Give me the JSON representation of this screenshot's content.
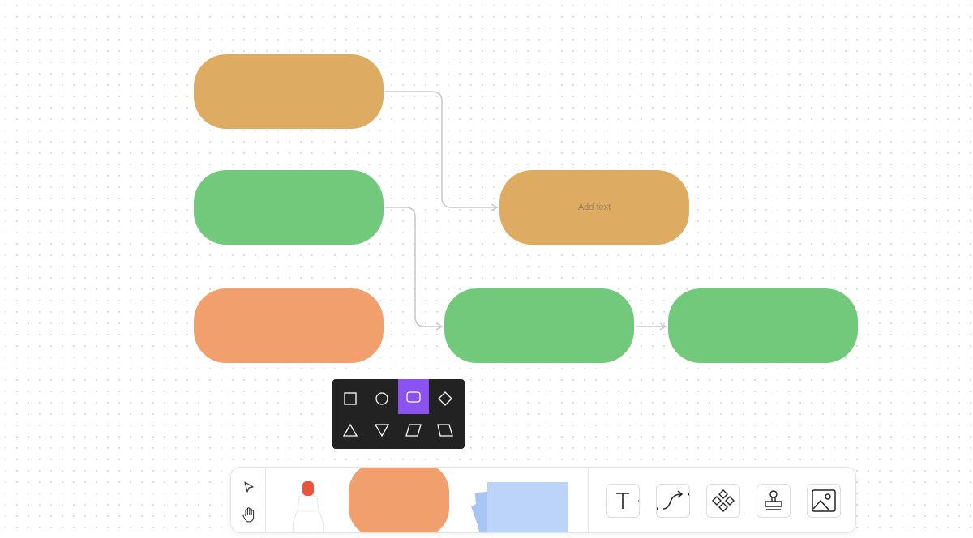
{
  "canvas": {
    "shapes": [
      {
        "color": "#DEAB62",
        "text": ""
      },
      {
        "color": "#73C97B",
        "text": ""
      },
      {
        "color": "#F19F6C",
        "text": ""
      },
      {
        "color": "#DEAB62",
        "text": "Add text"
      },
      {
        "color": "#73C97B",
        "text": ""
      },
      {
        "color": "#73C97B",
        "text": ""
      }
    ],
    "connector_color": "#c9c9c9"
  },
  "shape_picker": {
    "selected": "rounded-rectangle",
    "accent": "#8A52F0",
    "options": [
      "square",
      "circle",
      "rounded-rectangle",
      "diamond",
      "triangle",
      "inverted-triangle",
      "parallelogram",
      "trapezoid"
    ]
  },
  "toolbar": {
    "tools": [
      "select-arrow",
      "hand",
      "marker",
      "shape",
      "sticky-note",
      "text",
      "connector",
      "component",
      "stamp",
      "image"
    ],
    "marker_tip_color": "#E8553A",
    "shape_color": "#F19F6C",
    "sticky_color": "#B8D0F8"
  }
}
